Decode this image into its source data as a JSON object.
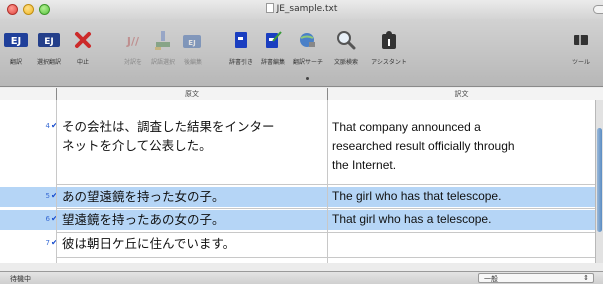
{
  "window": {
    "title": "JE_sample.txt"
  },
  "toolbar": {
    "items": [
      {
        "label": "翻訳",
        "color": "#1f3f9a"
      },
      {
        "label": "選択翻訳",
        "color": "#1f3f9a"
      },
      {
        "label": "中止",
        "color": "#cc2a2a"
      },
      {
        "label": "対訳を",
        "color": "#b34a4a"
      },
      {
        "label": "訳語選択",
        "color": "#3a7a3a"
      },
      {
        "label": "後編集",
        "color": "#2a5aa8"
      },
      {
        "label": "辞書引き",
        "color": "#1a3ec0"
      },
      {
        "label": "辞書編集",
        "color": "#1a3ec0"
      },
      {
        "label": "翻訳サーチ",
        "color": "#1a3ec0"
      },
      {
        "label": "文脈検索",
        "color": "#555555"
      },
      {
        "label": "アシスタント",
        "color": "#333333"
      },
      {
        "label": "ツール",
        "color": "#333333"
      }
    ]
  },
  "columns": {
    "source": "原文",
    "target": "訳文"
  },
  "rows": [
    {
      "num": "4",
      "source": [
        "その会社は、調査した結果をインター",
        "ネットを介して公表した。"
      ],
      "target": [
        "That company announced a",
        "researched result officially through",
        "the Internet."
      ],
      "selected": false
    },
    {
      "num": "5",
      "source": [
        "あの望遠鏡を持った女の子。"
      ],
      "target": [
        "The girl who has that telescope."
      ],
      "selected": true
    },
    {
      "num": "6",
      "source": [
        "望遠鏡を持ったあの女の子。"
      ],
      "target": [
        "That girl who has a telescope."
      ],
      "selected": true
    },
    {
      "num": "7",
      "source": [
        "彼は朝日ケ丘に住んでいます。"
      ],
      "target": [
        ""
      ],
      "selected": false
    }
  ],
  "status": {
    "text": "待機中",
    "mode": "一般"
  },
  "colors": {
    "selection": "#b5d5f6",
    "row_number": "#3a6cd4"
  }
}
